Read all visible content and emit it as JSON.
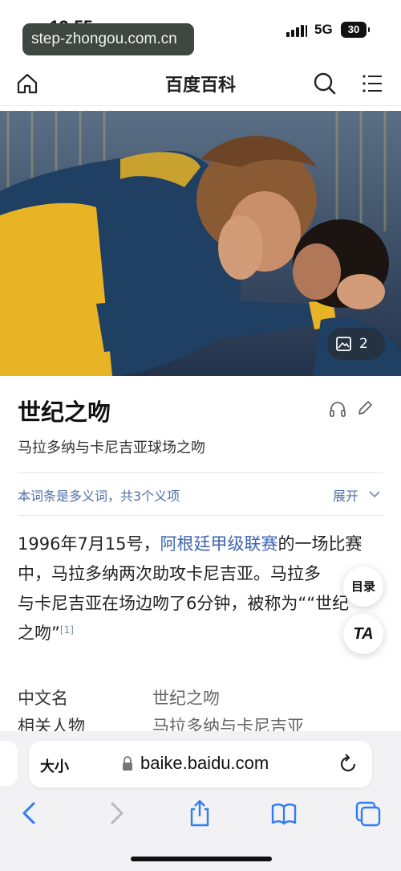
{
  "status_bar": {
    "time": "12:55",
    "network": "5G",
    "battery": "30",
    "url_overlay": "step-zhongou.com.cn"
  },
  "header": {
    "title": "百度百科",
    "icons": [
      "home-icon",
      "search-icon",
      "menu-icon"
    ]
  },
  "hero": {
    "gallery_count": "2",
    "icons": [
      "gallery-icon"
    ]
  },
  "entry": {
    "title": "世纪之吻",
    "subtitle": "马拉多纳与卡尼吉亚球场之吻",
    "polysemy_note": "本词条是多义词，共3个义项",
    "expand_label": "展开",
    "icons": [
      "headphones-icon",
      "edit-icon",
      "chevron-down-icon"
    ]
  },
  "summary": {
    "line1_before": "1996年7月15号，",
    "line1_link": "阿根廷甲级联赛",
    "line1_after": "的一场比赛",
    "line2": "中，马拉多纳两次助攻卡尼吉亚。马拉多",
    "line3": "与卡尼吉亚在场边吻了6分钟，被称为““世纪",
    "line4": "之吻”",
    "citation": "[1]"
  },
  "floating": {
    "toc_label": "目录",
    "text_size_label": "TA"
  },
  "infobox": [
    {
      "key": "中文名",
      "value": "世纪之吻"
    },
    {
      "key": "相关人物",
      "value": "马拉多纳与卡尼吉亚"
    }
  ],
  "safari": {
    "text_size_button": "大小",
    "address": "baike.baidu.com",
    "toolbar_icons": [
      "back-icon",
      "forward-icon",
      "share-icon",
      "bookmarks-icon",
      "tabs-icon"
    ]
  },
  "colors": {
    "link": "#3c64b4",
    "note": "#4f6fa8",
    "jersey_blue": "#1f3f63",
    "jersey_gold": "#e8b325"
  }
}
